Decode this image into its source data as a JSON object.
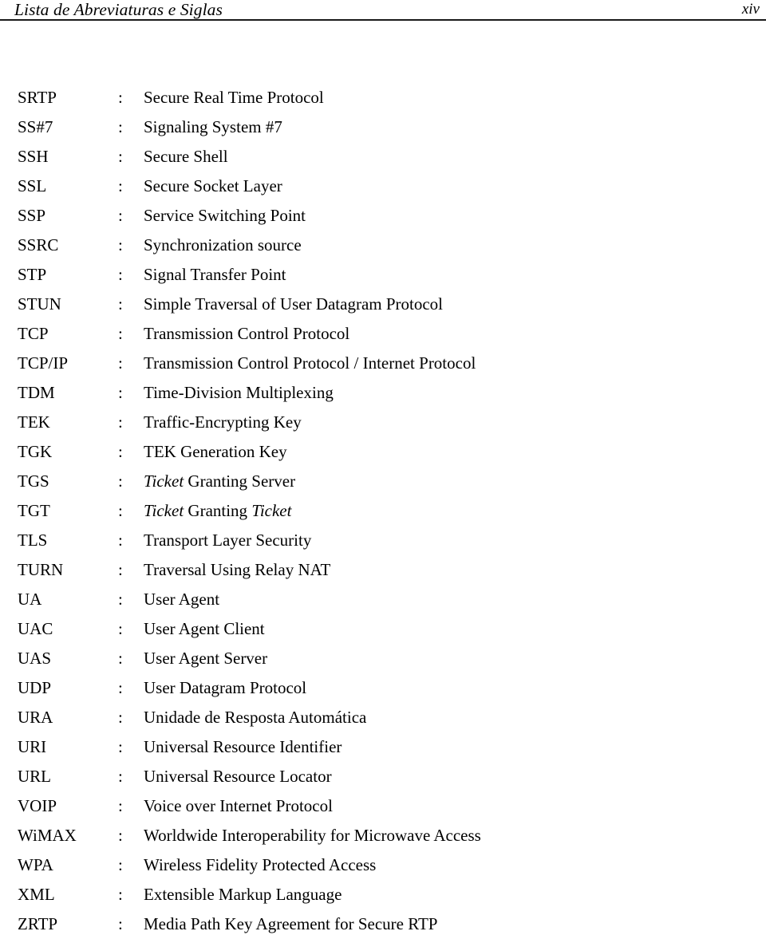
{
  "header": {
    "title": "Lista de Abreviaturas e Siglas",
    "folio": "xiv"
  },
  "list": {
    "separator": ":",
    "entries": [
      {
        "term": "SRTP",
        "definition": "Secure Real Time Protocol"
      },
      {
        "term": "SS#7",
        "definition": "Signaling System #7"
      },
      {
        "term": "SSH",
        "definition": "Secure Shell"
      },
      {
        "term": "SSL",
        "definition": "Secure Socket Layer"
      },
      {
        "term": "SSP",
        "definition": "Service Switching Point"
      },
      {
        "term": "SSRC",
        "definition": "Synchronization source"
      },
      {
        "term": "STP",
        "definition": "Signal Transfer Point"
      },
      {
        "term": "STUN",
        "definition": "Simple Traversal of User Datagram Protocol"
      },
      {
        "term": "TCP",
        "definition": "Transmission Control Protocol"
      },
      {
        "term": "TCP/IP",
        "definition": "Transmission Control Protocol / Internet Protocol"
      },
      {
        "term": "TDM",
        "definition": "Time-Division Multiplexing"
      },
      {
        "term": "TEK",
        "definition": "Traffic-Encrypting Key"
      },
      {
        "term": "TGK",
        "definition": "TEK Generation Key"
      },
      {
        "term": "TGS",
        "definition": "Ticket Granting Server",
        "definition_html": "<em>Ticket</em> Granting Server"
      },
      {
        "term": "TGT",
        "definition": "Ticket Granting Ticket",
        "definition_html": "<em>Ticket</em> Granting <em>Ticket</em>"
      },
      {
        "term": "TLS",
        "definition": "Transport Layer Security"
      },
      {
        "term": "TURN",
        "definition": "Traversal Using Relay NAT"
      },
      {
        "term": "UA",
        "definition": "User Agent"
      },
      {
        "term": "UAC",
        "definition": "User Agent Client"
      },
      {
        "term": "UAS",
        "definition": "User Agent Server"
      },
      {
        "term": "UDP",
        "definition": "User Datagram Protocol"
      },
      {
        "term": "URA",
        "definition": "Unidade de Resposta Automática"
      },
      {
        "term": "URI",
        "definition": "Universal Resource Identifier"
      },
      {
        "term": "URL",
        "definition": "Universal Resource Locator"
      },
      {
        "term": "VOIP",
        "definition": "Voice over Internet Protocol"
      },
      {
        "term": "WiMAX",
        "definition": "Worldwide Interoperability for Microwave Access"
      },
      {
        "term": "WPA",
        "definition": "Wireless Fidelity Protected Access"
      },
      {
        "term": "XML",
        "definition": "Extensible Markup Language"
      },
      {
        "term": "ZRTP",
        "definition": "Media Path Key Agreement for Secure RTP"
      }
    ]
  }
}
